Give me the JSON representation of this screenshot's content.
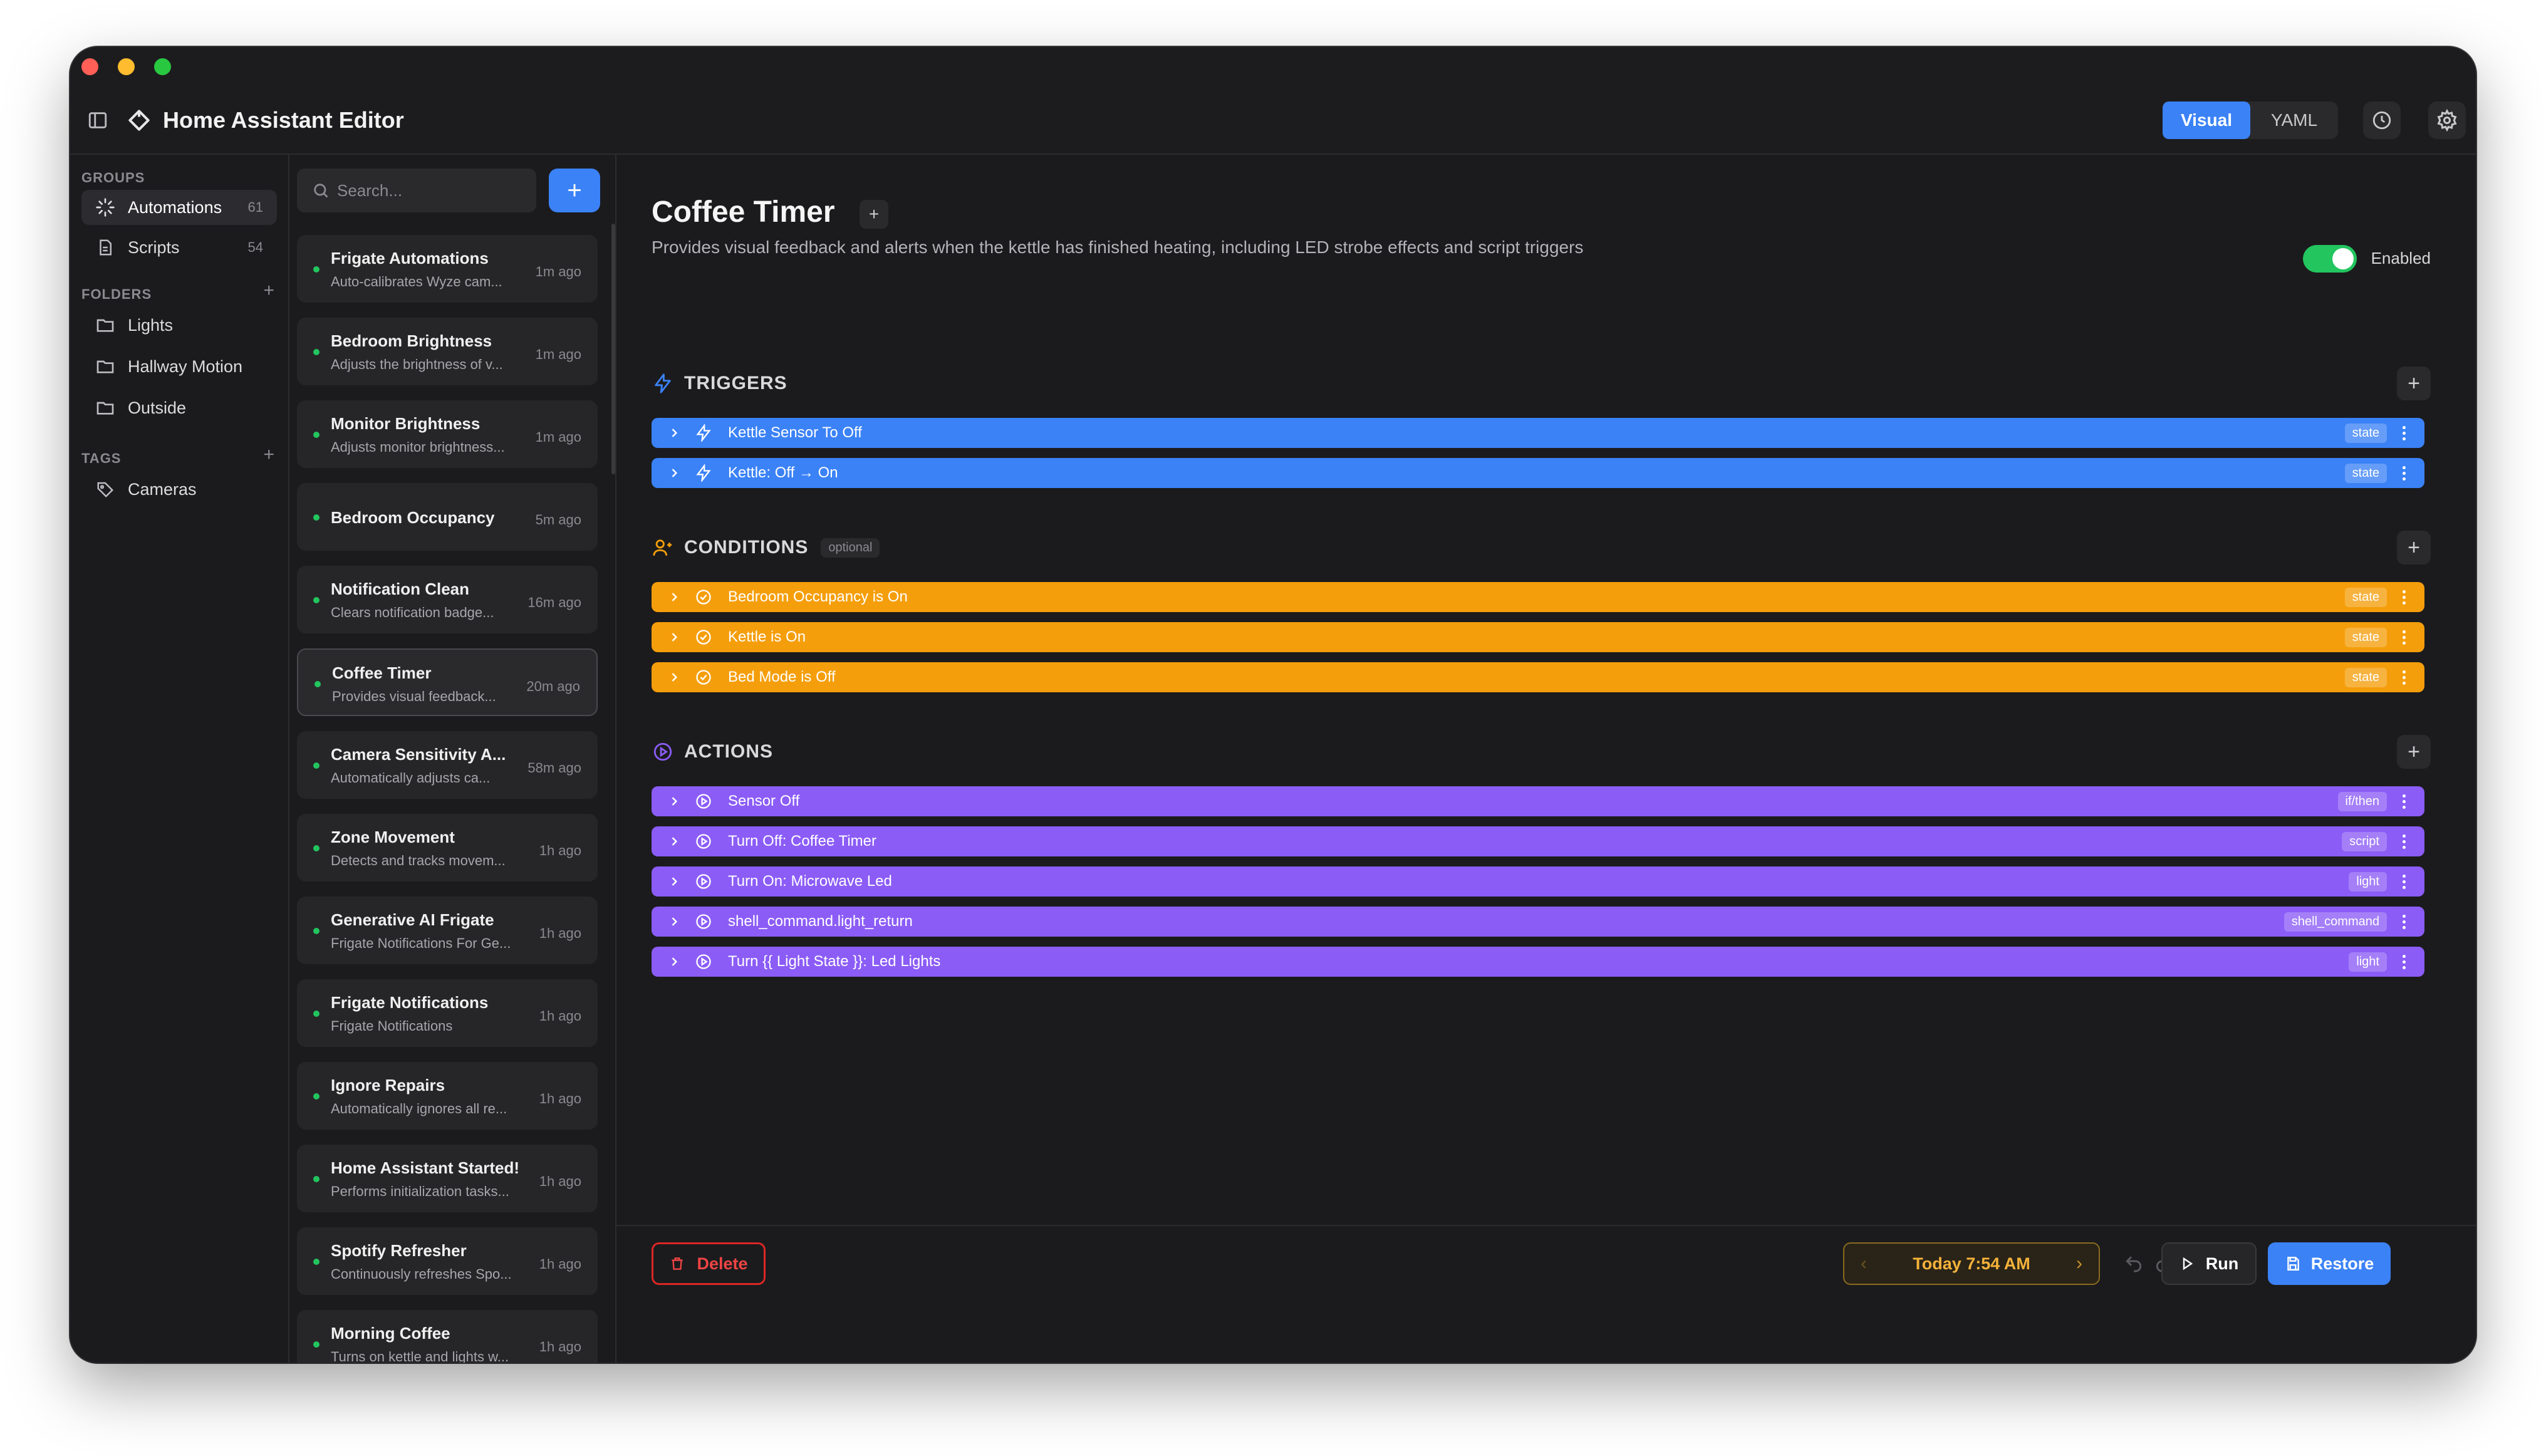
{
  "window": {
    "traffic_colors": [
      "#ff5f57",
      "#febc2e",
      "#28c840"
    ]
  },
  "header": {
    "title": "Home Assistant Editor",
    "modes": [
      "Visual",
      "YAML"
    ],
    "active_mode": "Visual"
  },
  "sidebar": {
    "groups_label": "GROUPS",
    "groups": [
      {
        "label": "Automations",
        "count": "61",
        "icon": "automations-icon"
      },
      {
        "label": "Scripts",
        "count": "54",
        "icon": "scripts-icon"
      }
    ],
    "folders_label": "FOLDERS",
    "folders": [
      {
        "label": "Lights"
      },
      {
        "label": "Hallway Motion"
      },
      {
        "label": "Outside"
      }
    ],
    "tags_label": "TAGS",
    "tags": [
      {
        "label": "Cameras"
      }
    ],
    "add_symbol": "+"
  },
  "list": {
    "search_placeholder": "Search...",
    "add_symbol": "+",
    "items": [
      {
        "title": "Frigate Automations",
        "subtitle": "Auto-calibrates Wyze cam...",
        "time": "1m ago"
      },
      {
        "title": "Bedroom Brightness",
        "subtitle": "Adjusts the brightness of v...",
        "time": "1m ago"
      },
      {
        "title": "Monitor Brightness",
        "subtitle": "Adjusts monitor brightness...",
        "time": "1m ago"
      },
      {
        "title": "Bedroom Occupancy",
        "subtitle": "",
        "time": "5m ago"
      },
      {
        "title": "Notification Clean",
        "subtitle": "Clears notification badge...",
        "time": "16m ago"
      },
      {
        "title": "Coffee Timer",
        "subtitle": "Provides visual feedback...",
        "time": "20m ago"
      },
      {
        "title": "Camera Sensitivity A...",
        "subtitle": "Automatically adjusts ca...",
        "time": "58m ago"
      },
      {
        "title": "Zone Movement",
        "subtitle": "Detects and tracks movem...",
        "time": "1h ago"
      },
      {
        "title": "Generative AI Frigate",
        "subtitle": "Frigate Notifications For Ge...",
        "time": "1h ago"
      },
      {
        "title": "Frigate Notifications",
        "subtitle": "Frigate Notifications",
        "time": "1h ago"
      },
      {
        "title": "Ignore Repairs",
        "subtitle": "Automatically ignores all re...",
        "time": "1h ago"
      },
      {
        "title": "Home Assistant Started!",
        "subtitle": "Performs initialization tasks...",
        "time": "1h ago"
      },
      {
        "title": "Spotify Refresher",
        "subtitle": "Continuously refreshes Spo...",
        "time": "1h ago"
      },
      {
        "title": "Morning Coffee",
        "subtitle": "Turns on kettle and lights w...",
        "time": "1h ago"
      }
    ]
  },
  "main": {
    "title": "Coffee Timer",
    "title_add": "+",
    "description": "Provides visual feedback and alerts when the kettle has finished heating, including LED strobe effects and script triggers",
    "enabled_label": "Enabled",
    "triggers_label": "TRIGGERS",
    "conditions_label": "CONDITIONS",
    "optional_label": "optional",
    "actions_label": "ACTIONS",
    "add_symbol": "+",
    "triggers": [
      {
        "label": "Kettle Sensor To Off",
        "badge": "state"
      },
      {
        "label": "Kettle: Off → On",
        "badge": "state"
      }
    ],
    "conditions": [
      {
        "label": "Bedroom Occupancy is On",
        "badge": "state"
      },
      {
        "label": "Kettle is On",
        "badge": "state"
      },
      {
        "label": "Bed Mode is Off",
        "badge": "state"
      }
    ],
    "actions": [
      {
        "label": "Sensor Off",
        "badge": "if/then"
      },
      {
        "label": "Turn Off: Coffee Timer",
        "badge": "script"
      },
      {
        "label": "Turn On: Microwave Led",
        "badge": "light"
      },
      {
        "label": "shell_command.light_return",
        "badge": "shell_command"
      },
      {
        "label": "Turn {{ Light State }}: Led Lights",
        "badge": "light"
      }
    ]
  },
  "footer": {
    "delete_label": "Delete",
    "time_label": "Today 7:54 AM",
    "run_label": "Run",
    "restore_label": "Restore"
  },
  "colors": {
    "accent": "#3b82f6",
    "trigger": "#3b82f6",
    "condition": "#f59e0b",
    "action": "#8b5cf6",
    "enabled": "#22c55e",
    "danger": "#ef4444",
    "time": "#f5b23a"
  }
}
